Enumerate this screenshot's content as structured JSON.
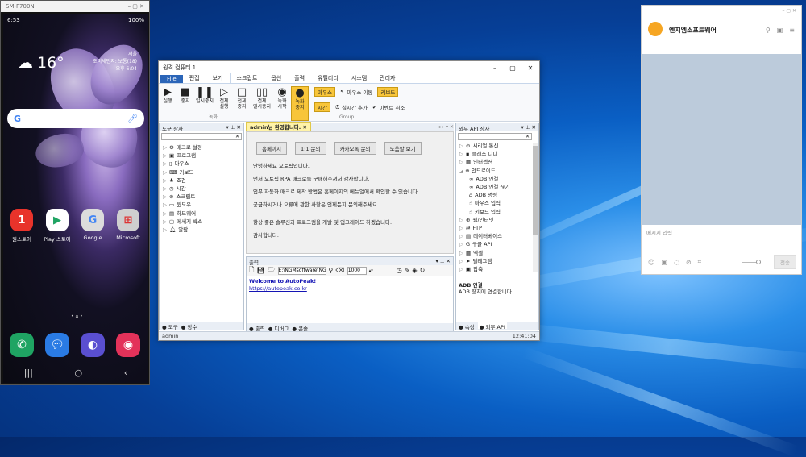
{
  "phone": {
    "window_title": "SM-F700N",
    "time": "6:53",
    "battery": "100%",
    "temp": "16°",
    "city": "서울",
    "fine_dust": "초미세먼지: 보통(18)",
    "updated": "오후 6:04",
    "apps": [
      {
        "label": "원스토어",
        "icon": "1",
        "color": "#e8332b"
      },
      {
        "label": "Play 스토어",
        "icon": "▶",
        "color": "#ffffff"
      },
      {
        "label": "Google",
        "icon": "G",
        "color": "#dcdcdc"
      },
      {
        "label": "Microsoft",
        "icon": "⊞",
        "color": "#cfcfcf"
      }
    ]
  },
  "window": {
    "title": "원격 컴퓨터 1",
    "menu": [
      "File",
      "편집",
      "보기",
      "스크립트",
      "옵션",
      "출력",
      "유틸리티",
      "시스템",
      "관리자"
    ],
    "ribbon": {
      "record": [
        "실행",
        "중지",
        "일시중지"
      ],
      "play": [
        "전체\n실행",
        "전체\n중지",
        "전체\n일시중지"
      ],
      "rec": [
        "녹화\n시작",
        "녹화\n중지"
      ],
      "group1": "녹화",
      "group2": "Group",
      "mouse": "마우스",
      "mouse_move": "마우스 이동",
      "keyboard": "키보드",
      "time": "시간",
      "realtime": "실시간 추가",
      "event_cancel": "이벤트 취소"
    },
    "tool_panel": {
      "title": "도구 상자",
      "items": [
        "매크로 설정",
        "프로그램",
        "마우스",
        "키보드",
        "조건",
        "시간",
        "스크립트",
        "윈도우",
        "하드웨어",
        "메세지 박스",
        "알람"
      ],
      "footer": [
        "도구",
        "장수"
      ]
    },
    "doc": {
      "tab": "admin님 환영합니다.",
      "links": [
        "홈페이지",
        "1:1 문의",
        "카카오톡 문의",
        "도움말 보기"
      ],
      "lines": [
        "안녕하세요 오토픽입니다.",
        "먼저 오토픽 RPA 매크로를 구매해주셔서 감사합니다.",
        "업무 자동화 매크로 제작 방법은 홈페이지의 메뉴얼에서 확인할 수 있습니다.",
        "궁금하시거나 오류에 관한 사항은 언제든지 문의해주세요.",
        "",
        "항상 좋은 솔루션과 프로그램을 개발 및 업그레이드 하겠습니다.",
        "감사합니다."
      ]
    },
    "output": {
      "title": "출력",
      "path": "E:\\NGMsoftware\\NG",
      "count": "1000",
      "welcome": "Welcome to AutoPeak!",
      "url": "https://autopeak.co.kr",
      "tabs": [
        "출력",
        "디버그",
        "콘솔"
      ]
    },
    "api_panel": {
      "title": "외부 API 상자",
      "items": [
        "시리얼 통신",
        "클래스 디디",
        "인터셉션",
        "안드로이드"
      ],
      "sub": [
        "ADB 연결",
        "ADB 연결 끊기",
        "ADB 명령",
        "마우스 입력",
        "키보드 입력"
      ],
      "more": [
        "웹/인터넷",
        "FTP",
        "데이터베이스",
        "구글 API",
        "엑셀",
        "텔레그램",
        "압축"
      ],
      "desc_title": "ADB 연결",
      "desc": "ADB 장치에 연결합니다.",
      "footer": [
        "속성",
        "외부 API"
      ]
    },
    "status": {
      "user": "admin",
      "time": "12:41:04"
    }
  },
  "chat": {
    "name": "엔지엠소프트웨어",
    "placeholder": "메시지 입력",
    "send": "전송"
  }
}
